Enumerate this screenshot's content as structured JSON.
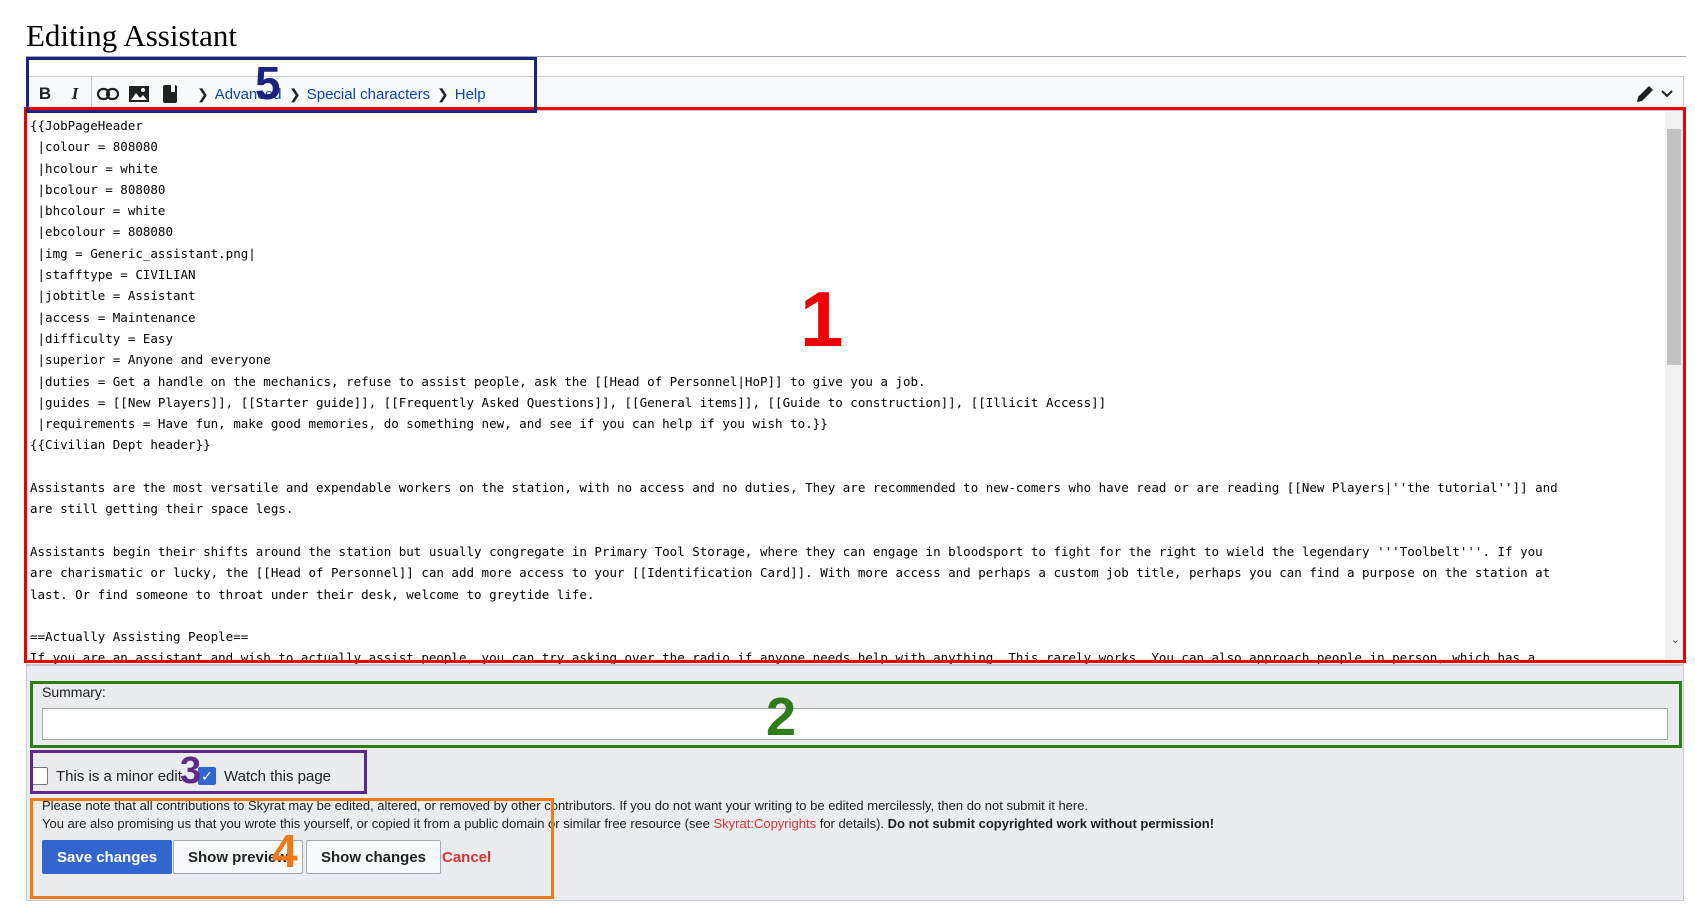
{
  "page": {
    "title": "Editing Assistant"
  },
  "toolbar": {
    "bold_label": "B",
    "italic_label": "I",
    "icons": [
      "bold-icon",
      "italic-icon",
      "link-icon",
      "image-icon",
      "reference-icon",
      "pencil-icon",
      "chevron-down-icon"
    ],
    "links": {
      "advanced": "Advanced",
      "special_characters": "Special characters",
      "help": "Help"
    }
  },
  "editor": {
    "content": "{{JobPageHeader\n |colour = 808080\n |hcolour = white\n |bcolour = 808080\n |bhcolour = white\n |ebcolour = 808080\n |img = Generic_assistant.png|\n |stafftype = CIVILIAN\n |jobtitle = Assistant\n |access = Maintenance\n |difficulty = Easy\n |superior = Anyone and everyone\n |duties = Get a handle on the mechanics, refuse to assist people, ask the [[Head of Personnel|HoP]] to give you a job.\n |guides = [[New Players]], [[Starter guide]], [[Frequently Asked Questions]], [[General items]], [[Guide to construction]], [[Illicit Access]]\n |requirements = Have fun, make good memories, do something new, and see if you can help if you wish to.}}\n{{Civilian Dept header}}\n\nAssistants are the most versatile and expendable workers on the station, with no access and no duties, They are recommended to new-comers who have read or are reading [[New Players|''the tutorial'']] and\nare still getting their space legs.\n\nAssistants begin their shifts around the station but usually congregate in Primary Tool Storage, where they can engage in bloodsport to fight for the right to wield the legendary '''Toolbelt'''. If you\nare charismatic or lucky, the [[Head of Personnel]] can add more access to your [[Identification Card]]. With more access and perhaps a custom job title, perhaps you can find a purpose on the station at\nlast. Or find someone to throat under their desk, welcome to greytide life.\n\n==Actually Assisting People==\nIf you are an assistant and wish to actually assist people, you can try asking over the radio if anyone needs help with anything. This rarely works. You can also approach people in person, which has a"
  },
  "summary": {
    "label": "Summary:",
    "value": ""
  },
  "checkboxes": {
    "minor_edit": {
      "label": "This is a minor edit",
      "checked": false
    },
    "watch_page": {
      "label": "Watch this page",
      "checked": true
    }
  },
  "license": {
    "line1": "Please note that all contributions to Skyrat may be edited, altered, or removed by other contributors. If you do not want your writing to be edited mercilessly, then do not submit it here.",
    "line2_prefix": "You are also promising us that you wrote this yourself, or copied it from a public domain or similar free resource (see ",
    "line2_link": "Skyrat:Copyrights",
    "line2_suffix": " for details). ",
    "line2_bold": "Do not submit copyrighted work without permission!"
  },
  "buttons": {
    "save": "Save changes",
    "preview": "Show preview",
    "diff": "Show changes",
    "cancel": "Cancel"
  },
  "annotations": [
    {
      "number": "1",
      "color": "#ee0000"
    },
    {
      "number": "2",
      "color": "#2e7d1a"
    },
    {
      "number": "3",
      "color": "#5e2a8a"
    },
    {
      "number": "4",
      "color": "#f07a18"
    },
    {
      "number": "5",
      "color": "#1a237e"
    }
  ]
}
